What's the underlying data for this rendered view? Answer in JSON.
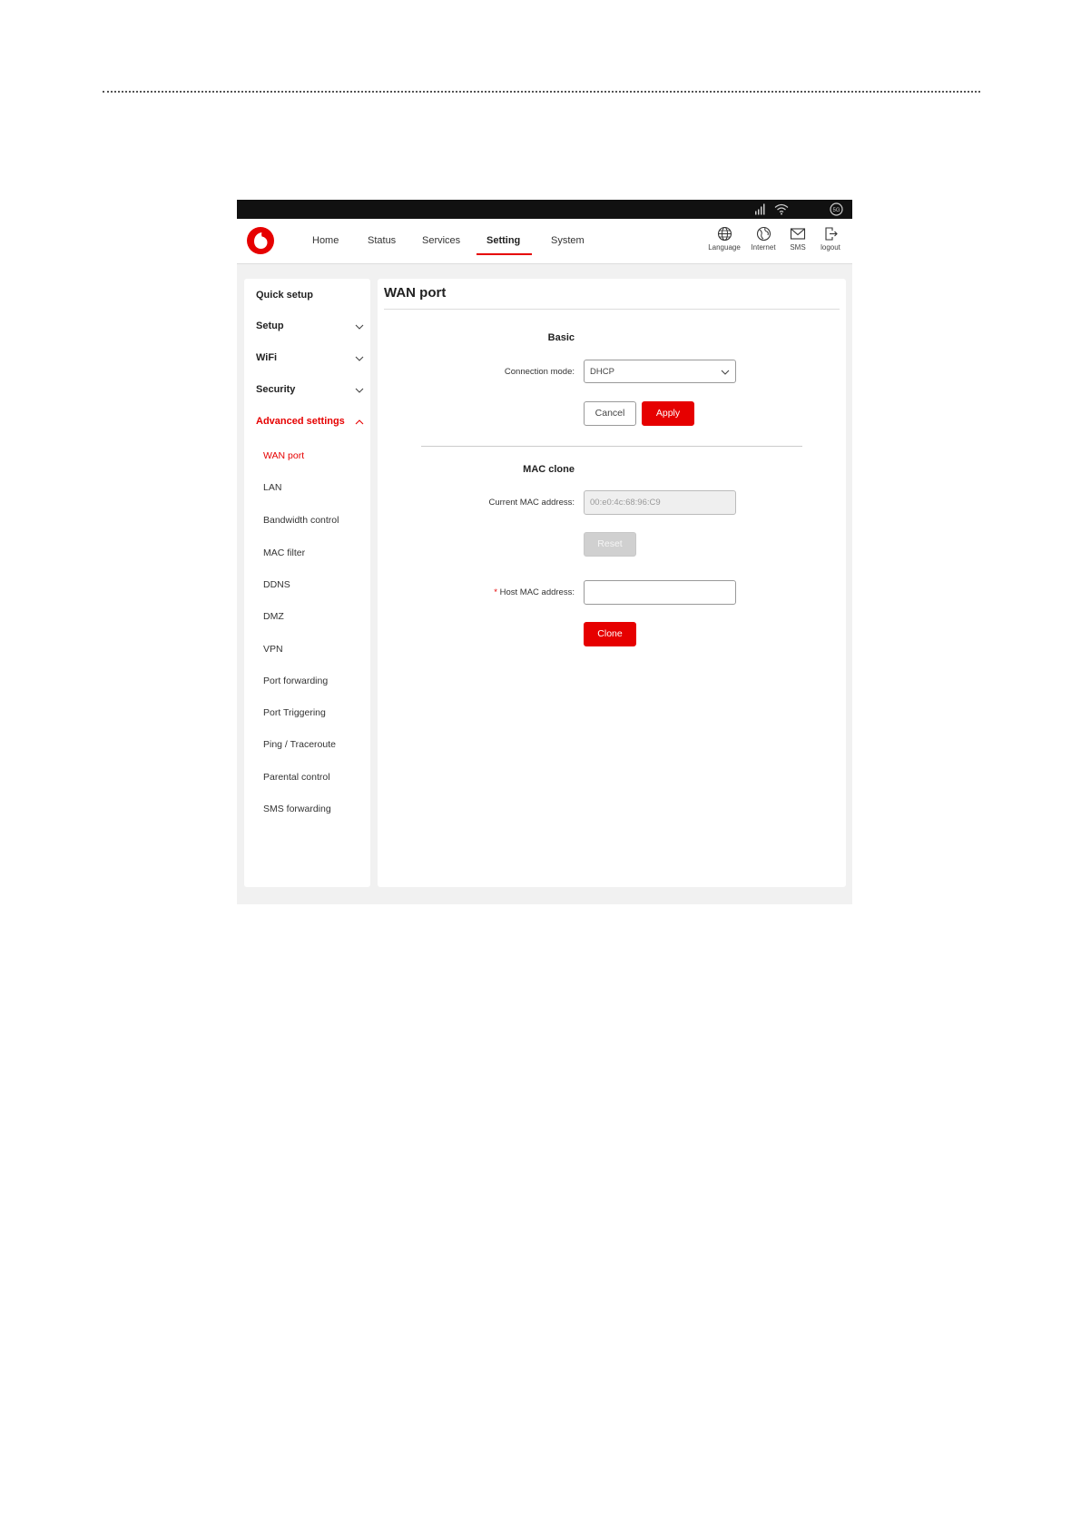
{
  "header": {
    "nav": [
      "Home",
      "Status",
      "Services",
      "Setting",
      "System"
    ],
    "active_nav": "Setting",
    "icons": [
      {
        "label": "Language",
        "icon": "globe-icon"
      },
      {
        "label": "Internet",
        "icon": "internet-icon"
      },
      {
        "label": "SMS",
        "icon": "mail-icon"
      },
      {
        "label": "logout",
        "icon": "logout-icon"
      }
    ],
    "status_icons": [
      "signal-icon",
      "wifi-icon",
      "5g-icon"
    ],
    "status_5g": "5G"
  },
  "sidebar": {
    "top": [
      {
        "label": "Quick setup",
        "expandable": false
      },
      {
        "label": "Setup",
        "expandable": true
      },
      {
        "label": "WiFi",
        "expandable": true
      },
      {
        "label": "Security",
        "expandable": true
      },
      {
        "label": "Advanced settings",
        "expandable": true,
        "expanded": true
      }
    ],
    "sub": [
      "WAN port",
      "LAN",
      "Bandwidth control",
      "MAC filter",
      "DDNS",
      "DMZ",
      "VPN",
      "Port forwarding",
      "Port Triggering",
      "Ping / Traceroute",
      "Parental control",
      "SMS forwarding"
    ],
    "active_sub": "WAN port"
  },
  "main": {
    "title": "WAN port",
    "basic": {
      "title": "Basic",
      "mode_label": "Connection mode:",
      "mode_value": "DHCP",
      "cancel": "Cancel",
      "apply": "Apply"
    },
    "mac": {
      "title": "MAC clone",
      "current_label": "Current MAC address:",
      "current_value": "00:e0:4c:68:96:C9",
      "reset": "Reset",
      "required_mark": "*",
      "host_label": "Host MAC address:",
      "host_value": "",
      "clone": "Clone"
    }
  },
  "colors": {
    "accent": "#e60000",
    "statusbar": "#111111"
  }
}
